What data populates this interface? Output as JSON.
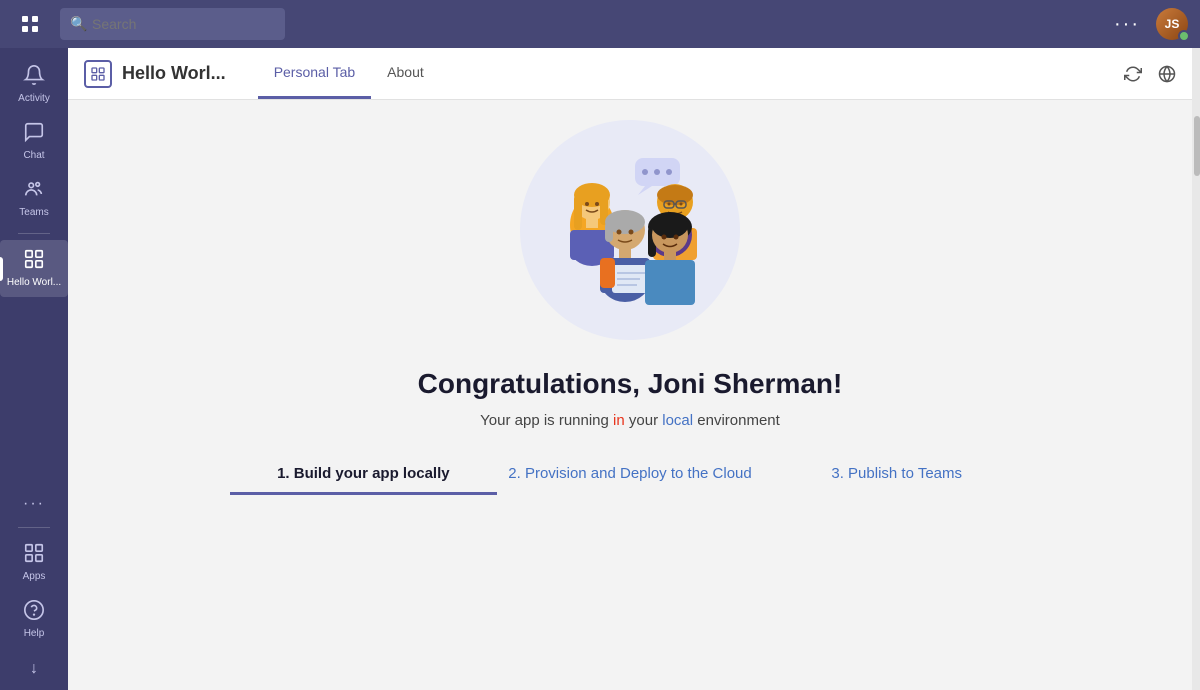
{
  "topbar": {
    "search_placeholder": "Search",
    "dots_label": "···",
    "avatar_initials": "JS"
  },
  "sidebar": {
    "items": [
      {
        "id": "activity",
        "label": "Activity",
        "icon": "🔔",
        "active": false
      },
      {
        "id": "chat",
        "label": "Chat",
        "icon": "💬",
        "active": false
      },
      {
        "id": "teams",
        "label": "Teams",
        "icon": "👥",
        "active": false
      },
      {
        "id": "hello-world",
        "label": "Hello Worl...",
        "icon": "▦",
        "active": true
      },
      {
        "id": "apps",
        "label": "Apps",
        "icon": "⊞",
        "active": false
      },
      {
        "id": "help",
        "label": "Help",
        "icon": "?",
        "active": false
      }
    ],
    "more_label": "···",
    "bottom_label": "↓"
  },
  "app_header": {
    "title": "Hello Worl...",
    "tabs": [
      {
        "id": "personal-tab",
        "label": "Personal Tab",
        "active": true
      },
      {
        "id": "about",
        "label": "About",
        "active": false
      }
    ]
  },
  "main": {
    "congrats_heading": "Congratulations, Joni Sherman!",
    "subtext_before": "Your app is running ",
    "subtext_in": "in",
    "subtext_mid": " your ",
    "subtext_local": "local",
    "subtext_after": " environment",
    "steps": [
      {
        "id": "step1",
        "number": "1.",
        "label": "Build your app locally",
        "active": true
      },
      {
        "id": "step2",
        "number": "2.",
        "label": "Provision and Deploy to the Cloud",
        "active": false
      },
      {
        "id": "step3",
        "number": "3.",
        "label": "Publish to Teams",
        "active": false
      }
    ]
  }
}
